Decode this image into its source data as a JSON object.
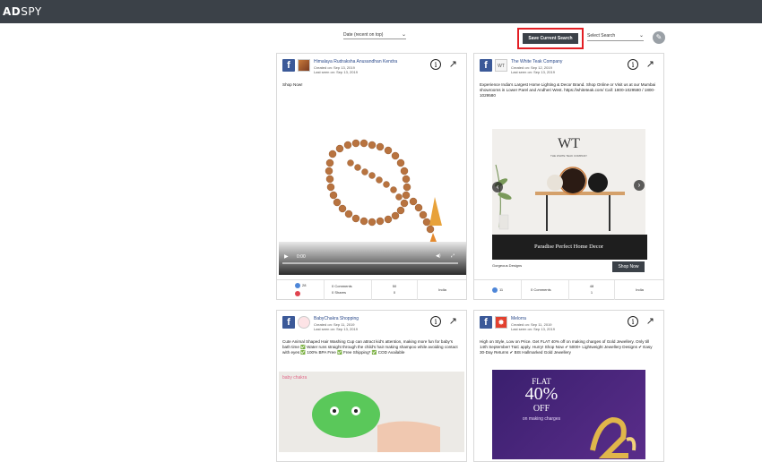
{
  "app": {
    "logo_bold": "AD",
    "logo_light": "SPY"
  },
  "toolbar": {
    "sort_value": "Date (recent on top)",
    "save_label": "Save Current Search",
    "select_search": "Select Search",
    "chevron": "⌄",
    "pencil": "✎"
  },
  "colors": {
    "topbar": "#3b4148",
    "highlight": "#e31e24",
    "facebook": "#3b5998"
  },
  "cards": [
    {
      "advertiser": "Himalaya Rudraksha Anusandhan Kendra",
      "created": "Created on: Sep 13, 2019",
      "last_seen": "Last seen on: Sep 13, 2019",
      "text": "Shop Now!",
      "video_time": "0:00",
      "reactions": "28",
      "comments": "0 Comments",
      "shares": "0 Shares",
      "views_top": "50",
      "views_bottom": "0",
      "country": "India"
    },
    {
      "advertiser": "The White Teak Company",
      "created": "Created on: Sep 12, 2019",
      "last_seen": "Last seen on: Sep 13, 2019",
      "text": "Experience India's Largest Home Lighting & Decor Brand. Shop Online or Visit us at our Mumbai showrooms in Lower Parel and Andheri West. https://whiteteak.com/ Call: 1800-1029580 / 1800-1029580",
      "brand_logo": "WT",
      "brand_name": "THE WHITE TEAK COMPANY",
      "headline": "Paradise Perfect Home Decor",
      "caption": "Gorgeous Designs",
      "cta": "Shop Now",
      "reactions": "11",
      "comments": "0 Comments",
      "views_top": "48",
      "views_bottom": "1",
      "country": "India"
    },
    {
      "advertiser": "BabyChakra Shopping",
      "created": "Created on: Sep 11, 2019",
      "last_seen": "Last seen on: Sep 13, 2019",
      "text": "Cute Animal Shaped Hair Washing Cup can attract kid's attention, making more fun for baby's bath time ✅ Water runs straight through the child's hair making shampoo while avoiding contact with eyes ✅ 100% BPA Free ✅ Free Shipping* ✅ COD Available",
      "image_label": "baby chakra"
    },
    {
      "advertiser": "Melorra",
      "created": "Created on: Sep 11, 2019",
      "last_seen": "Last seen on: Sep 13, 2019",
      "text": "High on Style, Low on Price. Get FLAT 40% off on making charges of Gold Jewellery. Only till 14th September! T&C apply. Hurry! Shop Now ✔ 5000+ Lightweight Jewellery Designs ✔ Easy 30-Day Returns ✔ BIS Hallmarked Gold Jewellery",
      "promo_flat": "FLAT",
      "promo_pct": "40%",
      "promo_off": "OFF",
      "promo_sub": "on making charges"
    }
  ]
}
